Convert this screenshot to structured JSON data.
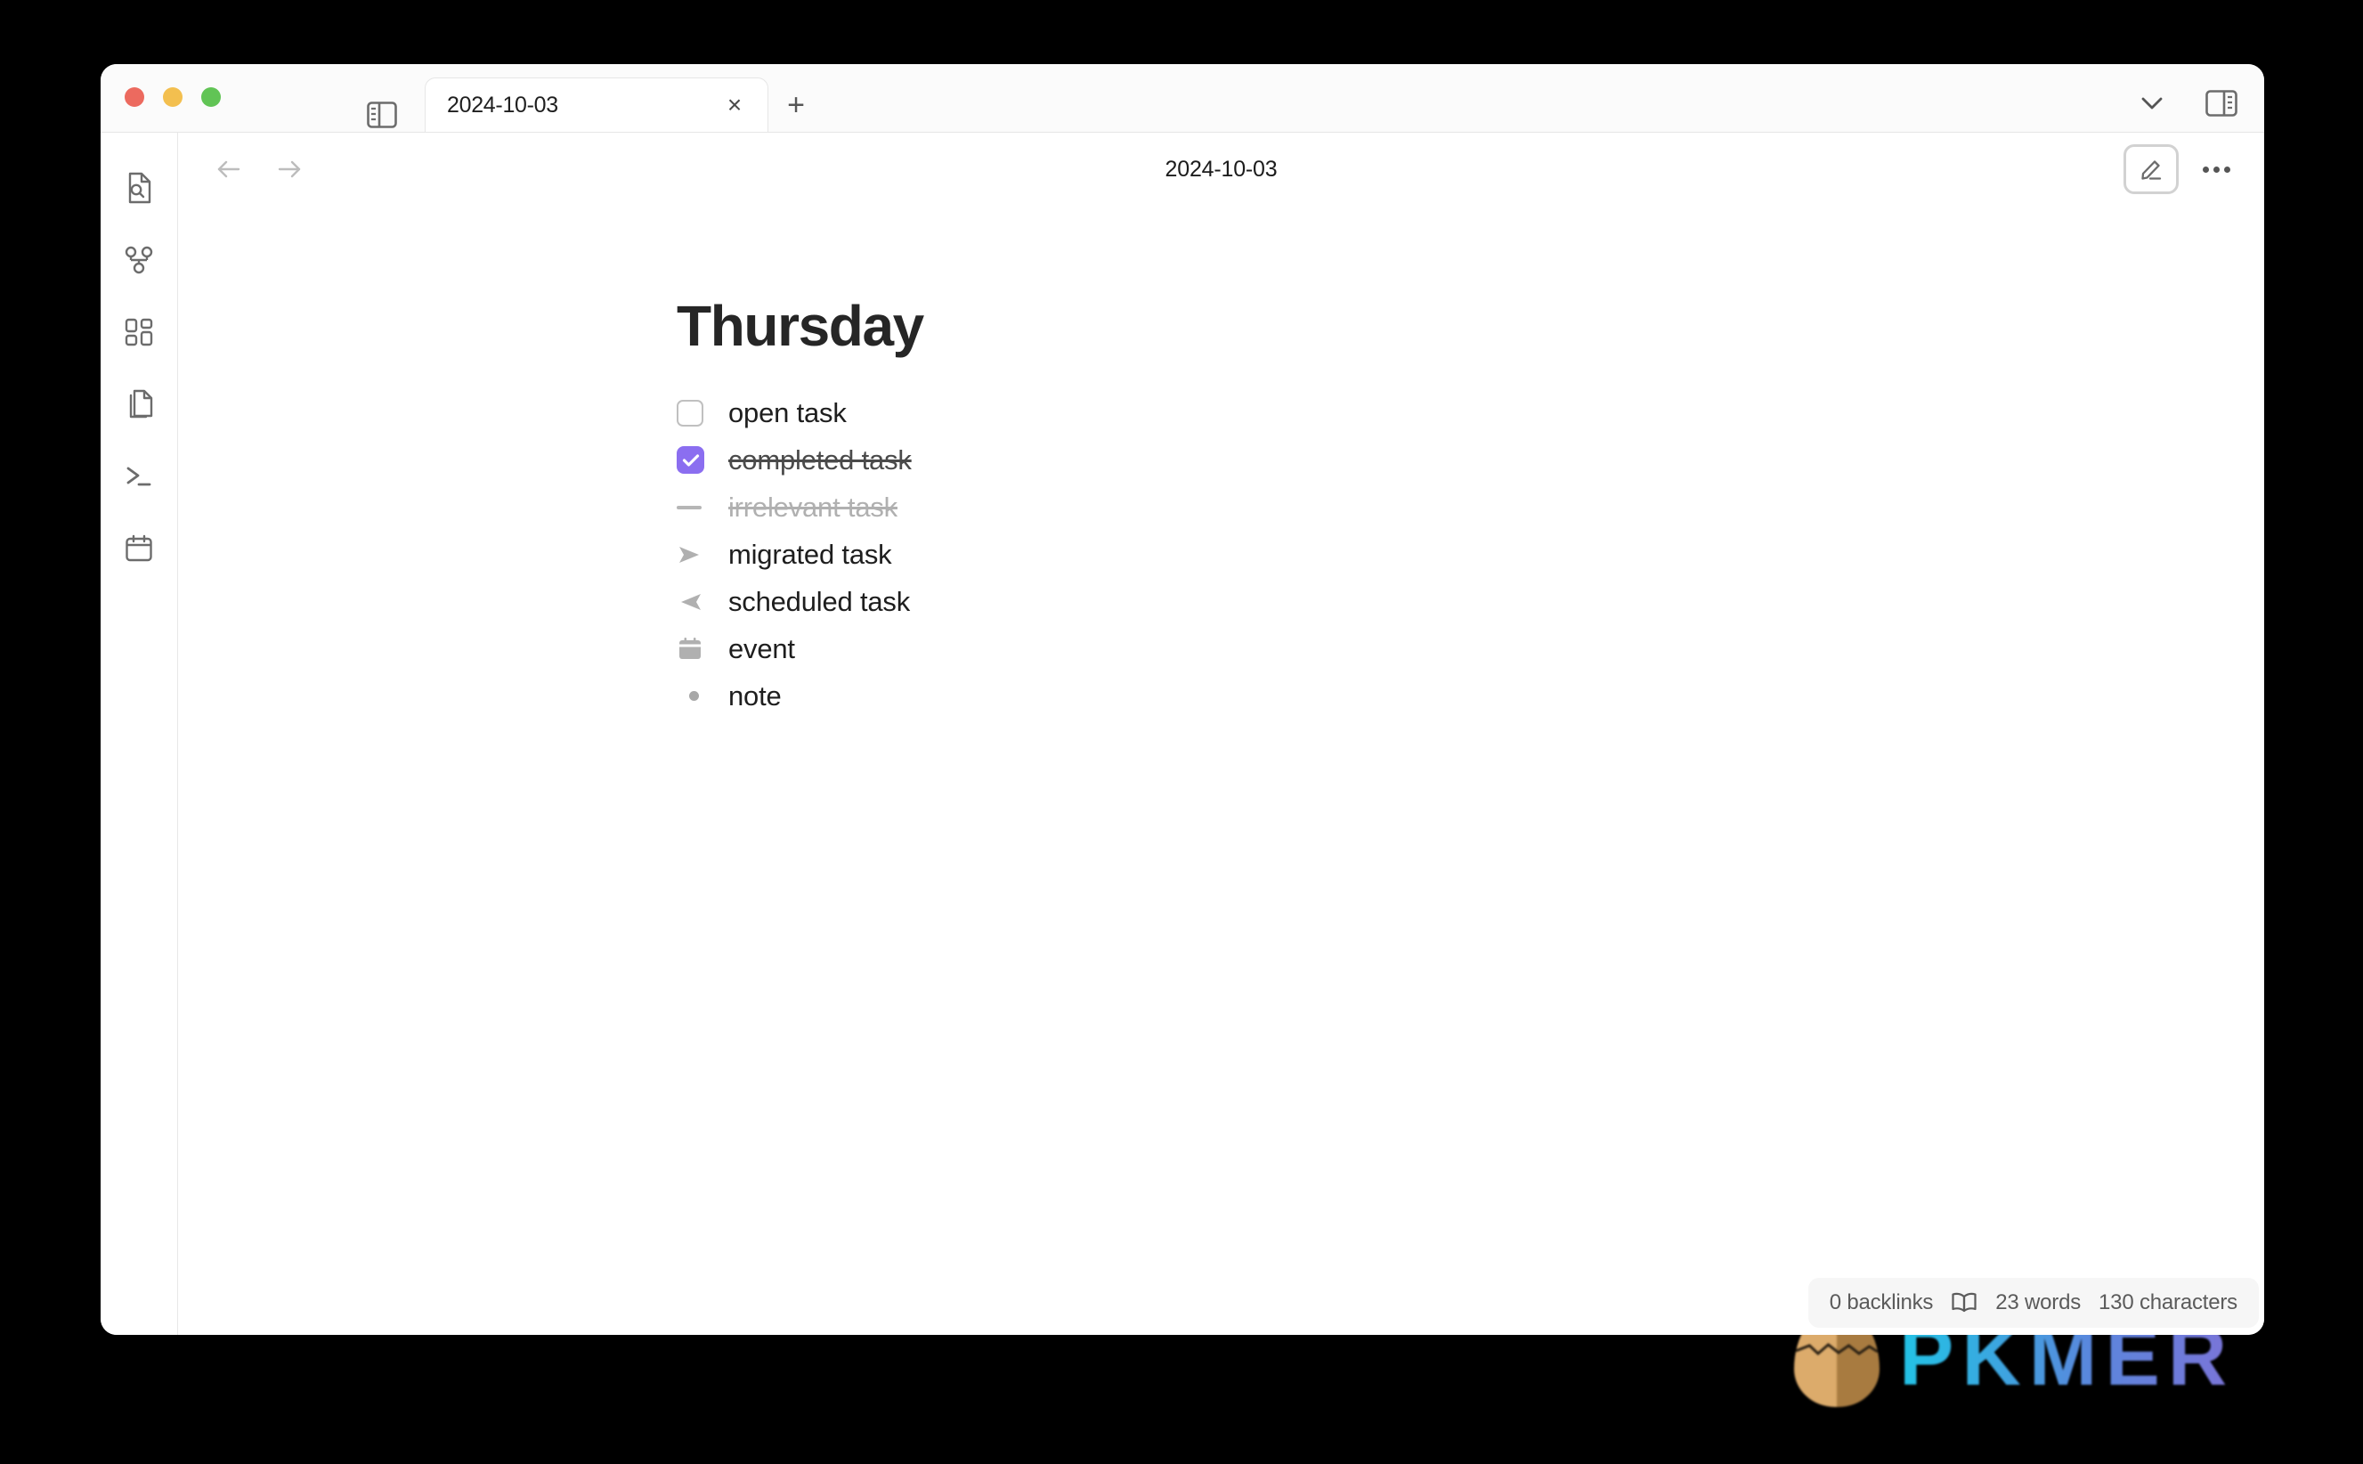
{
  "window": {
    "traffic_lights": [
      {
        "name": "close",
        "color": "#ec6a5f"
      },
      {
        "name": "minimize",
        "color": "#f3bf4f"
      },
      {
        "name": "maximize",
        "color": "#61c455"
      }
    ]
  },
  "titlebar": {
    "sidebar_toggle_icon": "left-sidebar-toggle-icon",
    "tab": {
      "label": "2024-10-03",
      "close_label": "×"
    },
    "new_tab_label": "+",
    "right_actions": [
      {
        "name": "chevron-down-icon",
        "label": ""
      },
      {
        "name": "right-sidebar-toggle-icon",
        "label": ""
      }
    ]
  },
  "ribbon": {
    "items": [
      {
        "name": "file-search-icon",
        "label": "Search in file"
      },
      {
        "name": "graph-view-icon",
        "label": "Graph view"
      },
      {
        "name": "dashboard-grid-icon",
        "label": "Dashboard"
      },
      {
        "name": "copy-files-icon",
        "label": "Files"
      },
      {
        "name": "terminal-icon",
        "label": "Terminal"
      },
      {
        "name": "calendar-icon",
        "label": "Calendar"
      }
    ]
  },
  "view_header": {
    "back_label": "←",
    "forward_label": "→",
    "title": "2024-10-03",
    "edit_toggle_name": "pencil-edit-icon",
    "more_menu_name": "more-options-icon"
  },
  "note": {
    "heading": "Thursday",
    "items": [
      {
        "marker": "checkbox-empty",
        "text": "open task",
        "style": "normal"
      },
      {
        "marker": "checkbox-checked",
        "text": "completed task",
        "style": "strike-dark"
      },
      {
        "marker": "dash",
        "text": "irrelevant task",
        "style": "muted-strike"
      },
      {
        "marker": "arrow-right",
        "text": "migrated task",
        "style": "normal"
      },
      {
        "marker": "arrow-left",
        "text": "scheduled task",
        "style": "normal"
      },
      {
        "marker": "calendar",
        "text": "event",
        "style": "normal"
      },
      {
        "marker": "bullet",
        "text": "note",
        "style": "normal"
      }
    ]
  },
  "statusbar": {
    "backlinks": "0 backlinks",
    "reading_icon": "open-book-icon",
    "words": "23 words",
    "characters": "130 characters"
  },
  "watermark": {
    "text": "PKMER",
    "logo_name": "cracked-egg-logo"
  },
  "colors": {
    "accent_checkbox": "#8b6ef0",
    "muted_text": "#b0b0b0",
    "marker_grey": "#b6b6b6"
  }
}
